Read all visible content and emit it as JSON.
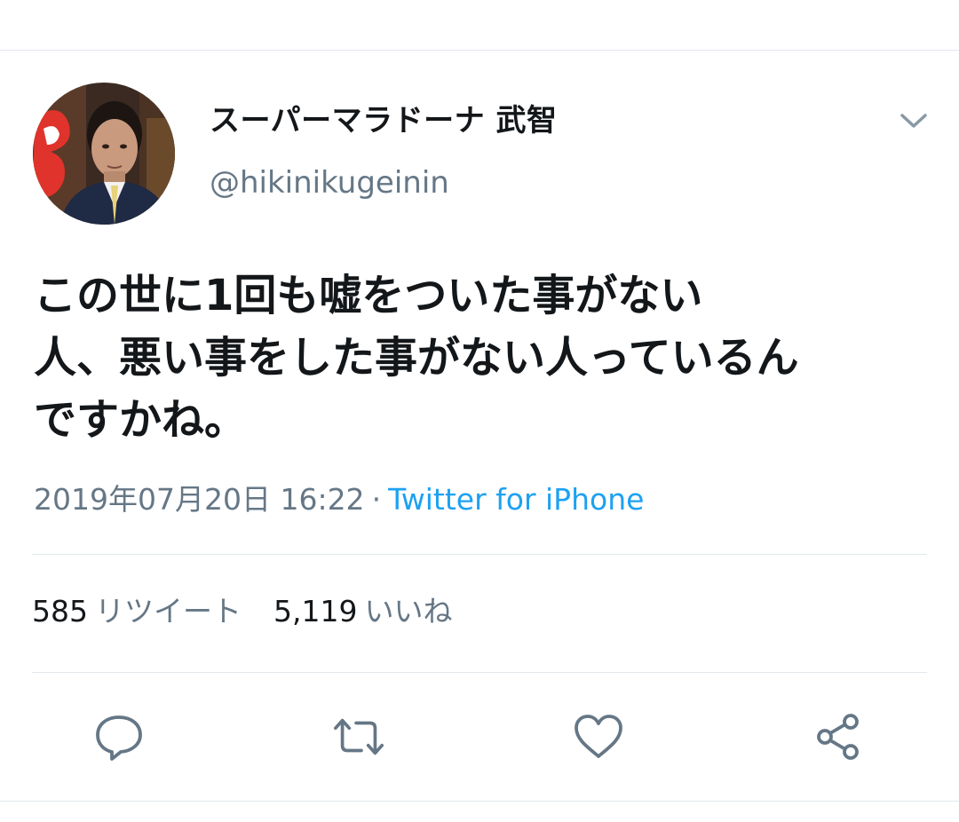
{
  "tweet": {
    "author": {
      "display_name": "スーパーマラドーナ 武智",
      "handle": "@hikinikugeinin",
      "avatar": "profile-photo"
    },
    "menu_icon": "chevron-down-icon",
    "text_lines": [
      "この世に1回も嘘をついた事がない",
      "人、悪い事をした事がない人っているん",
      "ですかね。"
    ],
    "timestamp": "2019年07月20日 16:22",
    "separator": "·",
    "source": "Twitter for iPhone",
    "stats": {
      "retweets_count": "585",
      "retweets_label": "リツイート",
      "likes_count": "5,119",
      "likes_label": "いいね"
    },
    "actions": [
      "reply-icon",
      "retweet-icon",
      "like-icon",
      "share-icon"
    ]
  },
  "colors": {
    "text": "#14171a",
    "secondary": "#657786",
    "link": "#1da1f2",
    "divider": "#e1e8ed"
  }
}
